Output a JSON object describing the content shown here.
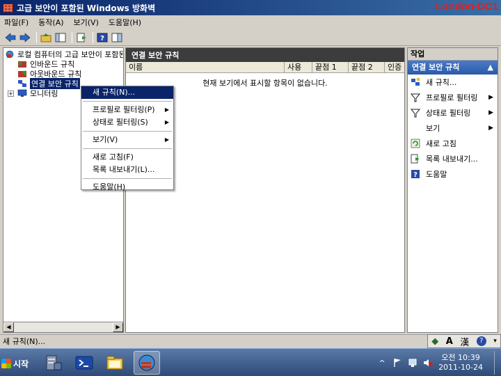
{
  "window": {
    "title": "고급 보안이 포함된 Windows 방화벽",
    "server_name": "London-DC1"
  },
  "menu": [
    "파일(F)",
    "동작(A)",
    "보기(V)",
    "도움말(H)"
  ],
  "tree": {
    "root": "로컬 컴퓨터의 고급 보안이 포함된",
    "items": [
      "인바운드 규칙",
      "아웃바운드 규칙",
      "연결 보안 규칙",
      "모니터링"
    ]
  },
  "center": {
    "header": "연결 보안 규칙",
    "columns": [
      "이름",
      "사용",
      "끝점 1",
      "끝점 2",
      "인증"
    ],
    "empty_message": "현재 보기에서 표시할 항목이 없습니다."
  },
  "actions": {
    "header": "작업",
    "section": "연결 보안 규칙",
    "items": [
      "새 규칙...",
      "프로필로 필터링",
      "상태로 필터링",
      "보기",
      "새로 고침",
      "목록 내보내기...",
      "도움말"
    ]
  },
  "context_menu": {
    "items": [
      "새 규칙(N)...",
      "프로필로 필터링(P)",
      "상태로 필터링(S)",
      "보기(V)",
      "새로 고침(F)",
      "목록 내보내기(L)...",
      "도움말(H)"
    ]
  },
  "status": {
    "text": "새 규칙(N)..."
  },
  "taskbar": {
    "start_label": "시작",
    "clock_time": "오전 10:39",
    "clock_date": "2011-10-24"
  },
  "ime": {
    "lang": "A",
    "hanja": "漢"
  },
  "colors": {
    "title_bar": "#0a246a",
    "server_name": "#e02020",
    "selection": "#0a246a",
    "action_section": "#2a5aa8"
  }
}
